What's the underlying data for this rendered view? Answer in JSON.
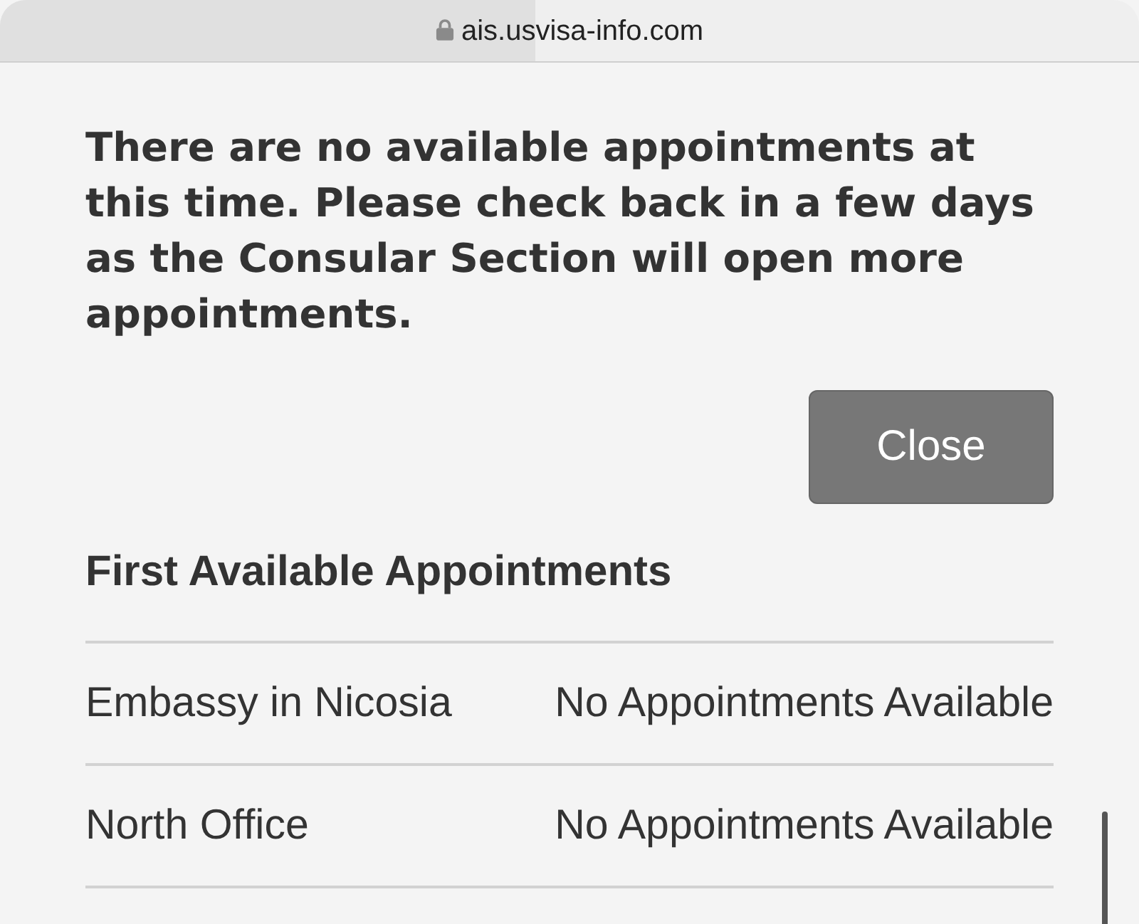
{
  "address_bar": {
    "url": "ais.usvisa-info.com",
    "level": 0.47
  },
  "message": "There are no available appointments at this time. Please check back in a few days as the Consular Section will open more appointments.",
  "close_button": {
    "label": "Close"
  },
  "section": {
    "title": "First Available Appointments",
    "rows": [
      {
        "location": "Embassy in Nicosia",
        "status": "No Appointments Available"
      },
      {
        "location": "North Office",
        "status": "No Appointments Available"
      }
    ]
  }
}
